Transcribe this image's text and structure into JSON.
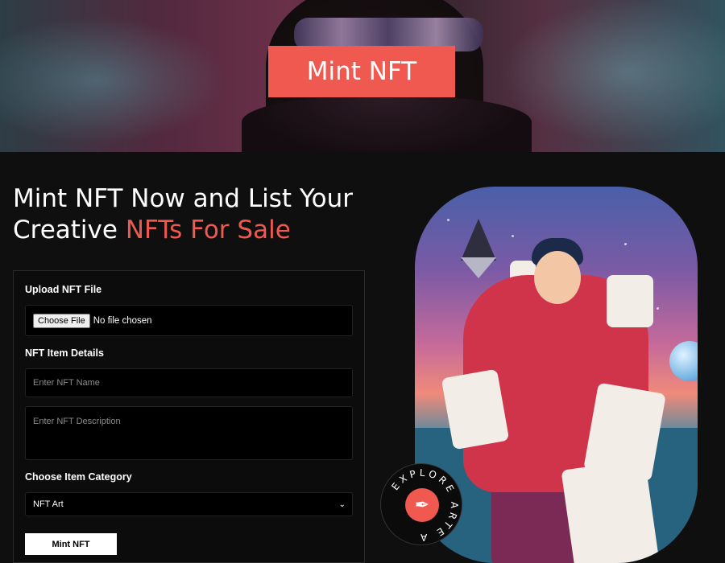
{
  "hero": {
    "title": "Mint NFT"
  },
  "intro": {
    "heading_line1": "Mint NFT Now and List Your",
    "heading_line2_plain": "Creative ",
    "heading_line2_accent": "NFTs For Sale"
  },
  "form": {
    "upload_label": "Upload NFT File",
    "file_button": "Choose File",
    "file_status": "No file chosen",
    "details_label": "NFT Item Details",
    "name_placeholder": "Enter NFT Name",
    "description_placeholder": "Enter NFT Description",
    "category_label": "Choose Item Category",
    "category_selected": "NFT Art",
    "submit_label": "Mint NFT"
  },
  "badge": {
    "ring_text": "EXPLORE ARTE A"
  },
  "colors": {
    "accent": "#f0594f",
    "background": "#0f0f0f"
  },
  "icons": {
    "ethereum": "ethereum-icon",
    "select_arrow": "chevron-down-icon",
    "badge_mark": "quill-icon"
  }
}
